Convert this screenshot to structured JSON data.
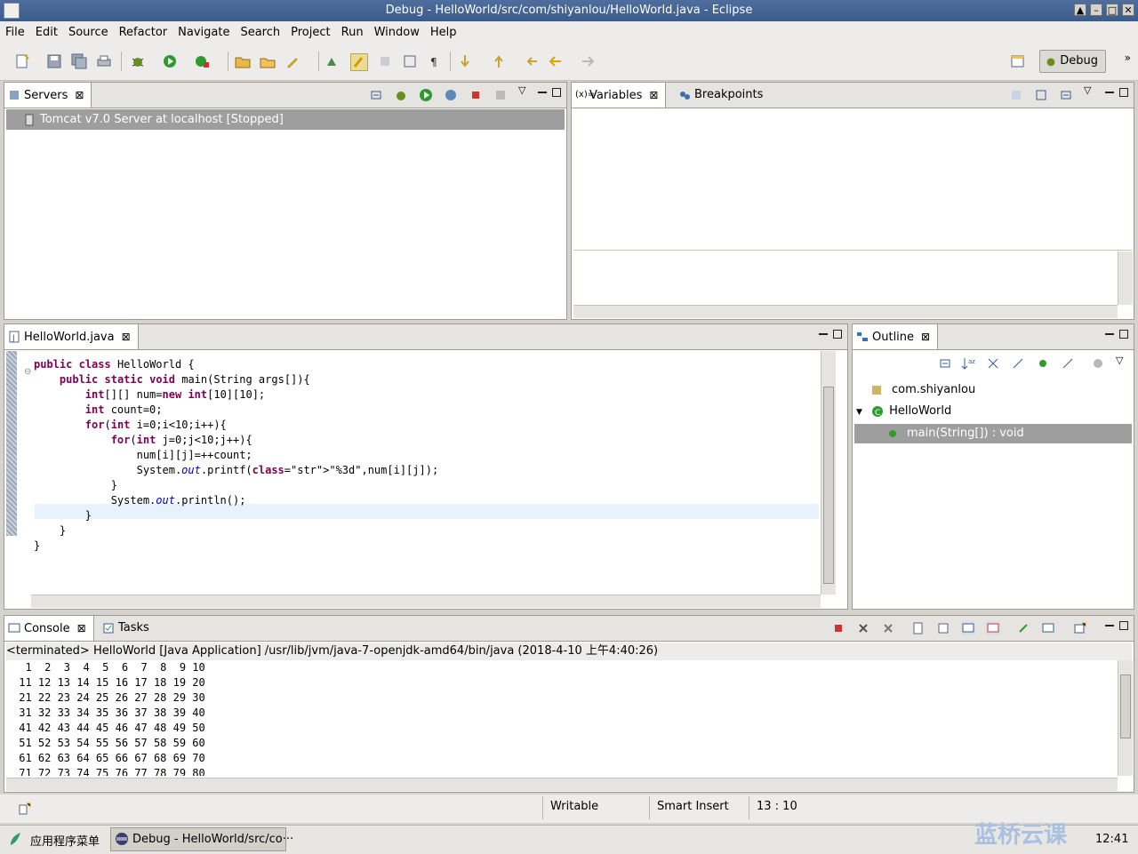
{
  "window": {
    "title": "Debug - HelloWorld/src/com/shiyanlou/HelloWorld.java - Eclipse"
  },
  "menu": [
    "File",
    "Edit",
    "Source",
    "Refactor",
    "Navigate",
    "Search",
    "Project",
    "Run",
    "Window",
    "Help"
  ],
  "perspective": {
    "label": "Debug"
  },
  "servers": {
    "tab": "Servers",
    "item": "Tomcat v7.0 Server at localhost  [Stopped]"
  },
  "variables": {
    "tab": "Variables",
    "tab2": "Breakpoints"
  },
  "editor": {
    "tab": "HelloWorld.java",
    "lines": [
      "public class HelloWorld {",
      "    public static void main(String args[]){",
      "        int[][] num=new int[10][10];",
      "        int count=0;",
      "        for(int i=0;i<10;i++){",
      "            for(int j=0;j<10;j++){",
      "                num[i][j]=++count;",
      "                System.out.printf(\"%3d\",num[i][j]);",
      "            }",
      "            System.out.println();",
      "        }",
      "    }",
      "}"
    ]
  },
  "outline": {
    "tab": "Outline",
    "package": "com.shiyanlou",
    "class": "HelloWorld",
    "method": "main(String[]) : void"
  },
  "console": {
    "tab": "Console",
    "tab2": "Tasks",
    "header": "<terminated> HelloWorld [Java Application] /usr/lib/jvm/java-7-openjdk-amd64/bin/java (2018-4-10 上午4:40:26)",
    "output": "  1  2  3  4  5  6  7  8  9 10\n 11 12 13 14 15 16 17 18 19 20\n 21 22 23 24 25 26 27 28 29 30\n 31 32 33 34 35 36 37 38 39 40\n 41 42 43 44 45 46 47 48 49 50\n 51 52 53 54 55 56 57 58 59 60\n 61 62 63 64 65 66 67 68 69 70\n 71 72 73 74 75 76 77 78 79 80"
  },
  "statusbar": {
    "writable": "Writable",
    "insert": "Smart Insert",
    "position": "13 : 10"
  },
  "taskbar": {
    "apps_menu": "应用程序菜单",
    "window": "Debug - HelloWorld/src/co···",
    "clock": "12:41",
    "watermark": "蓝桥云课"
  }
}
